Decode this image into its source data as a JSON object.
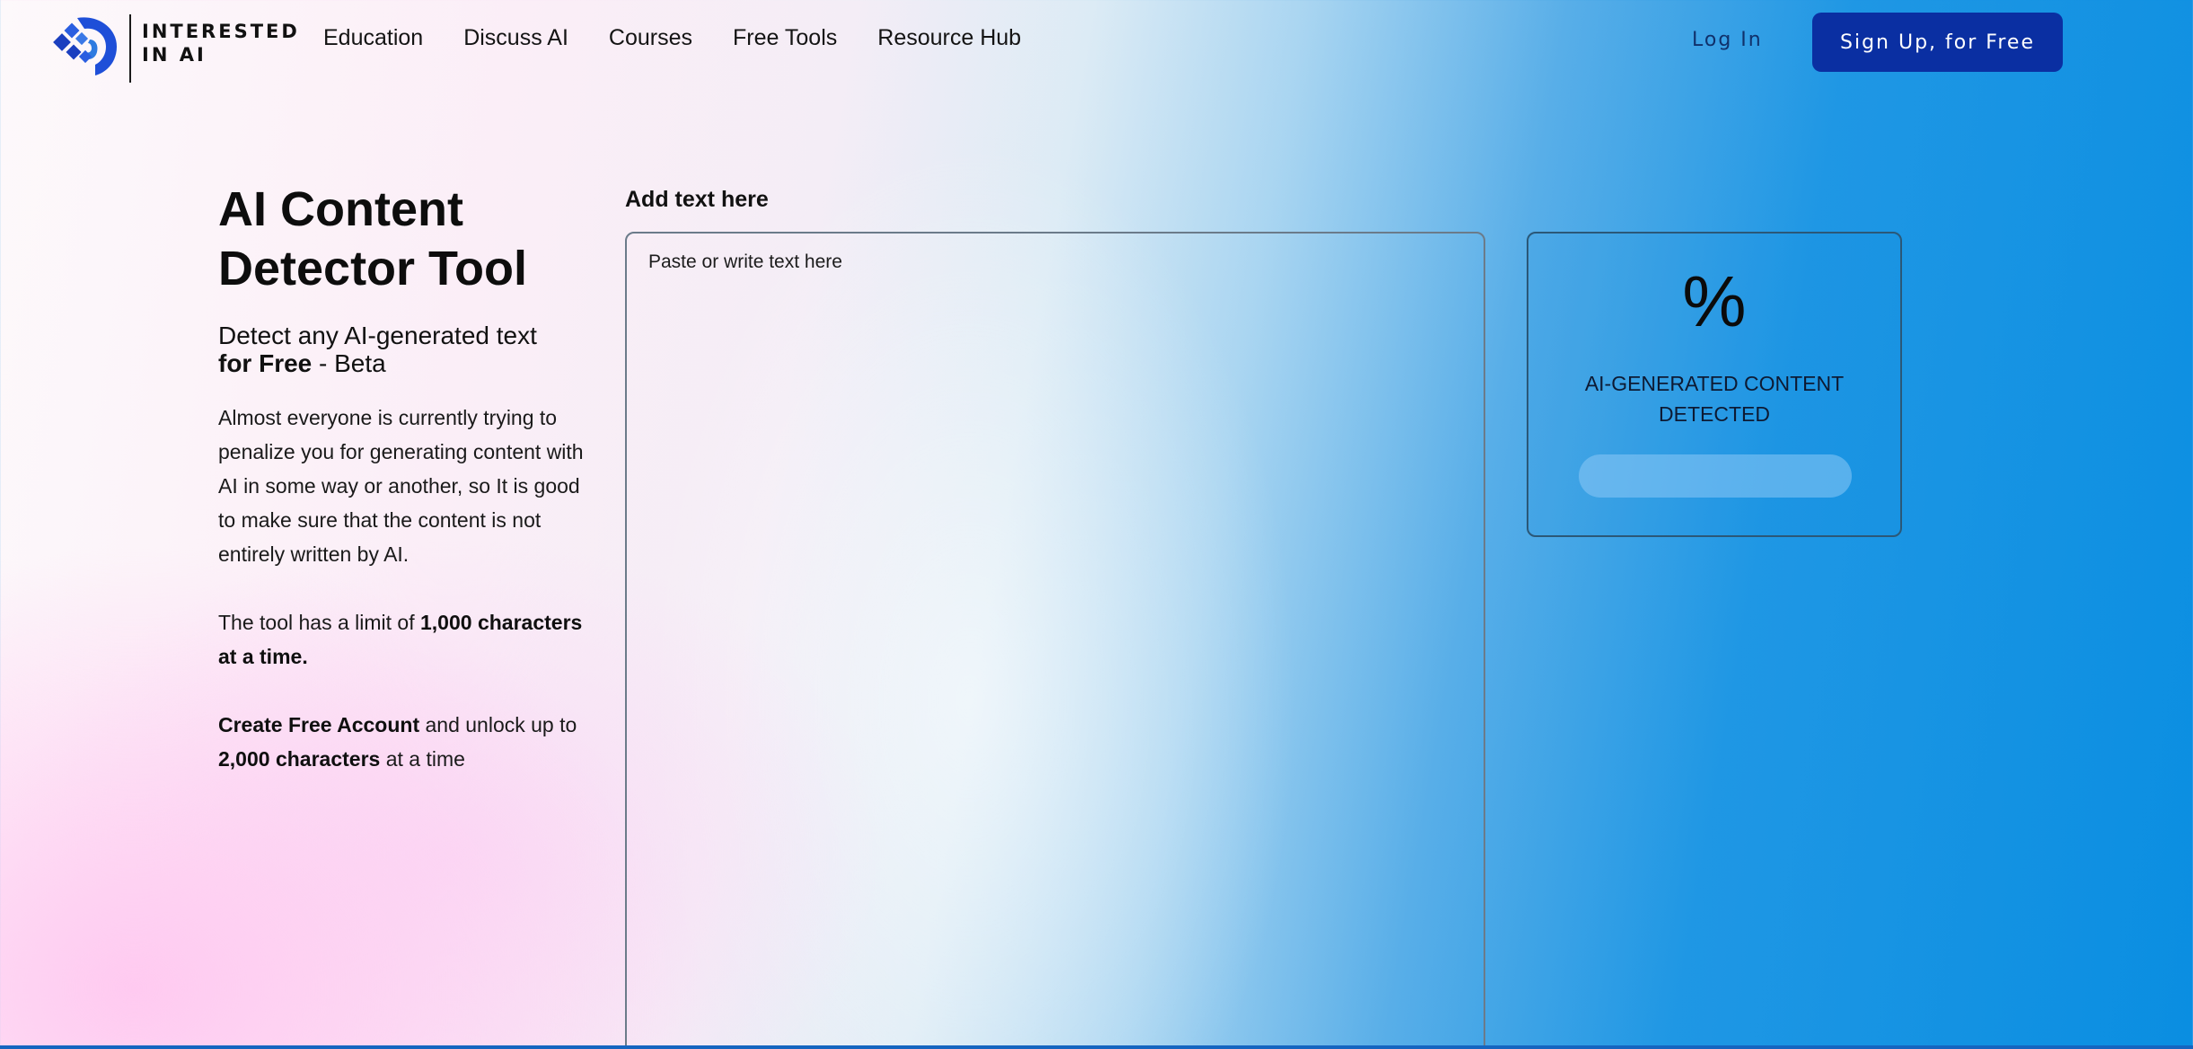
{
  "brand": {
    "line1": "INTERESTED",
    "line2": "IN AI",
    "icon": "brain-head-logo-icon",
    "color": "#1e4fd8"
  },
  "nav": {
    "items": [
      {
        "label": "Education"
      },
      {
        "label": "Discuss AI"
      },
      {
        "label": "Courses"
      },
      {
        "label": "Free Tools"
      },
      {
        "label": "Resource Hub"
      }
    ],
    "login_label": "Log In",
    "signup_label": "Sign Up, for Free",
    "signup_color": "#0a2fa2"
  },
  "intro": {
    "title_line1": "AI Content",
    "title_line2": "Detector Tool",
    "subtitle_text": "Detect any AI-generated text",
    "subtitle_bold": "for Free",
    "subtitle_suffix": " - Beta",
    "description": "Almost everyone is currently trying to penalize you for generating content with AI in some way or another, so It is good to make sure that the content is not entirely written by AI.",
    "limit_prefix": "The tool has a limit of ",
    "limit_bold": "1,000 characters at a time.",
    "account_bold": "Create Free Account",
    "account_mid": " and unlock up to ",
    "account_bold2": "2,000 characters",
    "account_suffix": " at a time"
  },
  "editor": {
    "label": "Add text here",
    "placeholder": "Paste or write text here",
    "value": ""
  },
  "result": {
    "percent_symbol": "%",
    "label_line1": "AI-GENERATED CONTENT",
    "label_line2": "DETECTED",
    "progress_fraction": 0
  }
}
